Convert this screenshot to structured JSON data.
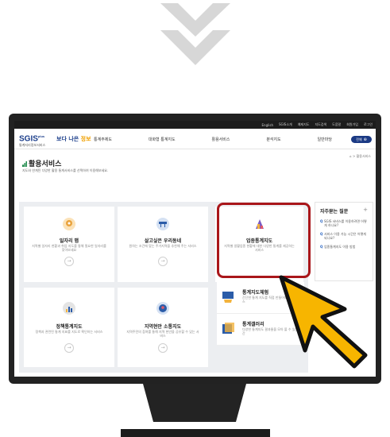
{
  "topbar": {
    "links": [
      "English",
      "SGIS소개",
      "예제지도",
      "지도검색",
      "도움말",
      "회원가입",
      "로그인"
    ]
  },
  "header": {
    "logo": "SGIS",
    "logo_sup": "plus",
    "logo_sub": "통계지리정보서비스",
    "brand_text": "보다 나은",
    "brand_emph": "정보",
    "nav": [
      "통계주제도",
      "대화형 통계지도",
      "활용서비스",
      "분석지도",
      "일반마당"
    ],
    "all_button": "전체"
  },
  "breadcrumb": "⌂ > 활용서비스",
  "page": {
    "title": "활용서비스",
    "desc": "지도와 연계된 다양한 활용 통계서비스를 선택하여 이용해보세요."
  },
  "cards": [
    {
      "title": "일자리 맵",
      "desc": "지역별 일자리 현황과 취업 지도를 통해 필요한 일자리를 찾아보세요",
      "icon": "job-map-icon",
      "color": "#e9a23b"
    },
    {
      "title": "살고싶은 우리동네",
      "desc": "원하는 조건에 맞는 주거지역을 추천해 주는 서비스",
      "icon": "neighborhood-icon",
      "color": "#2b5ca8"
    },
    {
      "title": "업종통계지도",
      "desc": "지역별 생활업종 현황에 대한 다양한 통계를 제공하는 서비스",
      "icon": "business-map-icon",
      "color": "#7a5bc2"
    },
    {
      "title": "정책통계지도",
      "desc": "정책과 관련된 통계 지표를 지도로 확인하는 서비스",
      "icon": "policy-map-icon",
      "color": "#2b5ca8"
    },
    {
      "title": "지역현안 소통지도",
      "desc": "지역주민의 참여를 통해 지역 현안을 공유할 수 있는 서비스",
      "icon": "community-map-icon",
      "color": "#2b5ca8"
    }
  ],
  "side_items": [
    {
      "title": "통계지도체험",
      "desc": "간단한 통계 지도를 직접 만들어보는 체험 서비스"
    },
    {
      "title": "통계갤러리",
      "desc": "다양한 통계지도 결과물을 모아 볼 수 있는 공간"
    }
  ],
  "faq": {
    "title": "자주묻는 질문",
    "plus": "+",
    "items": [
      "SGIS 서비스를 이용하려면 어떻게 하나요?",
      "서비스 이용 가능 시간은 어떻게 되나요?",
      "업종통계지도 이용 방법"
    ]
  },
  "go_arrow": "→",
  "colors": {
    "accent_red": "#a9161a",
    "cursor_yellow": "#f7b500",
    "nav_blue": "#1b3a84"
  }
}
